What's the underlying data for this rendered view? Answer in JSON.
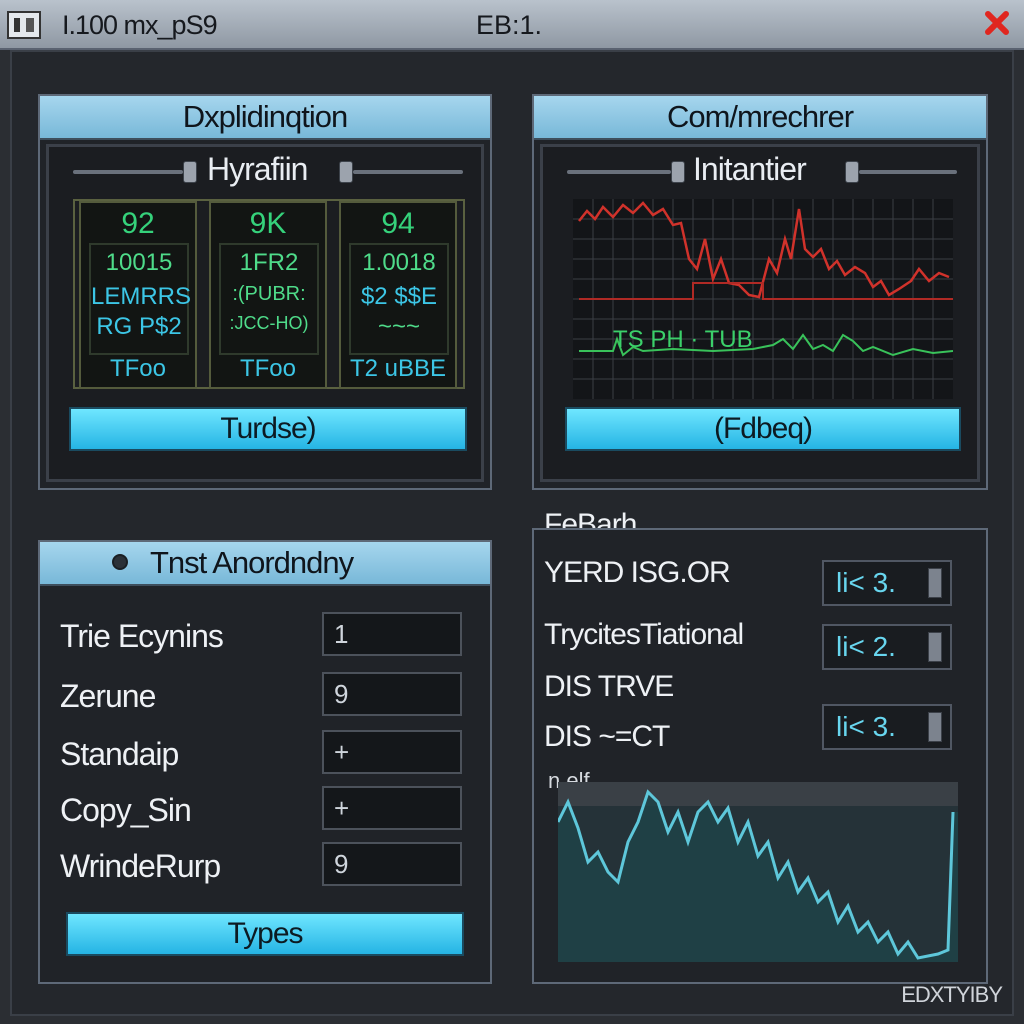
{
  "titlebar": {
    "title": "I.100 mx_pS9",
    "center": "EB:1.",
    "icons": [
      "window-menu-icon",
      "close-icon"
    ]
  },
  "panels": {
    "top_left": {
      "title": "Dxplidinqtion",
      "slider_label": "Hyrafiin",
      "cells": [
        {
          "top": "92",
          "lines": [
            "10015",
            "LEMRRS",
            "RG P$2"
          ],
          "bottom": "TFoo"
        },
        {
          "top": "9K",
          "lines": [
            "1FR2",
            ":(PUBR:",
            ":JCC-HO)"
          ],
          "bottom": "TFoo"
        },
        {
          "top": "94",
          "lines": [
            "1.0018",
            "$2 $$E",
            "~~~"
          ],
          "bottom": "T2 uBBE"
        }
      ],
      "button": "Turdse)"
    },
    "top_right": {
      "title": "Com/mrechrer",
      "slider_label": "Initantier",
      "chart_text": "TS PH · TUB",
      "button": "(Fdbeq)"
    },
    "bottom_left": {
      "title": "Tnst Anordndny",
      "rows": [
        {
          "label": "Trie Ecynins",
          "value": "1"
        },
        {
          "label": "Zerune",
          "value": "9"
        },
        {
          "label": "Standaip",
          "value": "+"
        },
        {
          "label": "Copy_Sin",
          "value": "+"
        },
        {
          "label": "WrindeRurp",
          "value": "9"
        }
      ],
      "button": "Types"
    },
    "bottom_right": {
      "title": "FeBarh",
      "rows": [
        {
          "label": "YERD ISG.OR",
          "value": "li< 3."
        },
        {
          "label": "TrycitesTiational",
          "value": "li< 2."
        },
        {
          "label": "DIS TRVE",
          "value": ""
        },
        {
          "label": "DIS ~=CT",
          "value": "li< 3."
        }
      ],
      "graph_label": "n elf"
    }
  },
  "footer": {
    "corner": "EDXTYIBY"
  },
  "colors": {
    "accent_cyan": "#3fd0f4",
    "panel_header": "#8ec9e6",
    "trace_red": "#d0322b",
    "trace_green": "#39c25a",
    "trace_cyan": "#58c8d8"
  }
}
